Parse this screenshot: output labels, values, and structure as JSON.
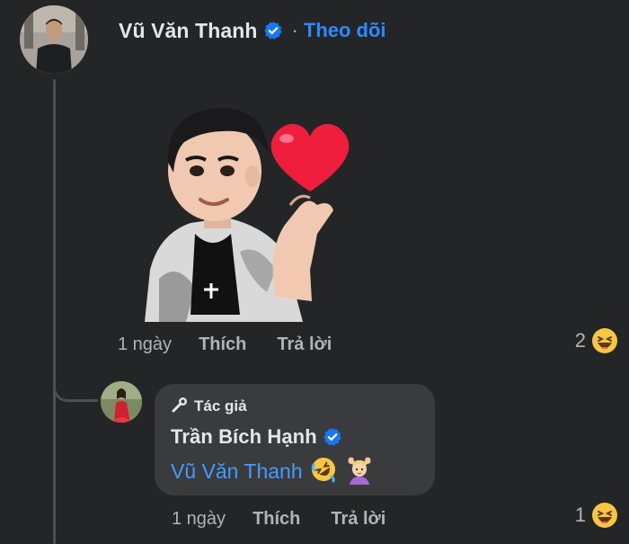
{
  "comment": {
    "author": "Vũ Văn Thanh",
    "separator": "·",
    "follow_label": "Theo dõi",
    "time": "1 ngày",
    "like_label": "Thích",
    "reply_label": "Trả lời",
    "reaction_count": "2",
    "reaction_icon": "haha-reaction-icon",
    "sticker": "heart-finger-avatar-sticker"
  },
  "reply": {
    "author_tag": "Tác giả",
    "author": "Trần Bích Hạnh",
    "mention": "Vũ Văn Thanh",
    "emojis": [
      "rolling-on-floor-laughing-icon",
      "person-gesturing-ok-icon"
    ],
    "time": "1 ngày",
    "like_label": "Thích",
    "reply_label": "Trả lời",
    "reaction_count": "1",
    "reaction_icon": "haha-reaction-icon"
  },
  "colors": {
    "background": "#242526",
    "bubble": "#3a3b3c",
    "link": "#2e89ff",
    "verified": "#1877f2"
  }
}
